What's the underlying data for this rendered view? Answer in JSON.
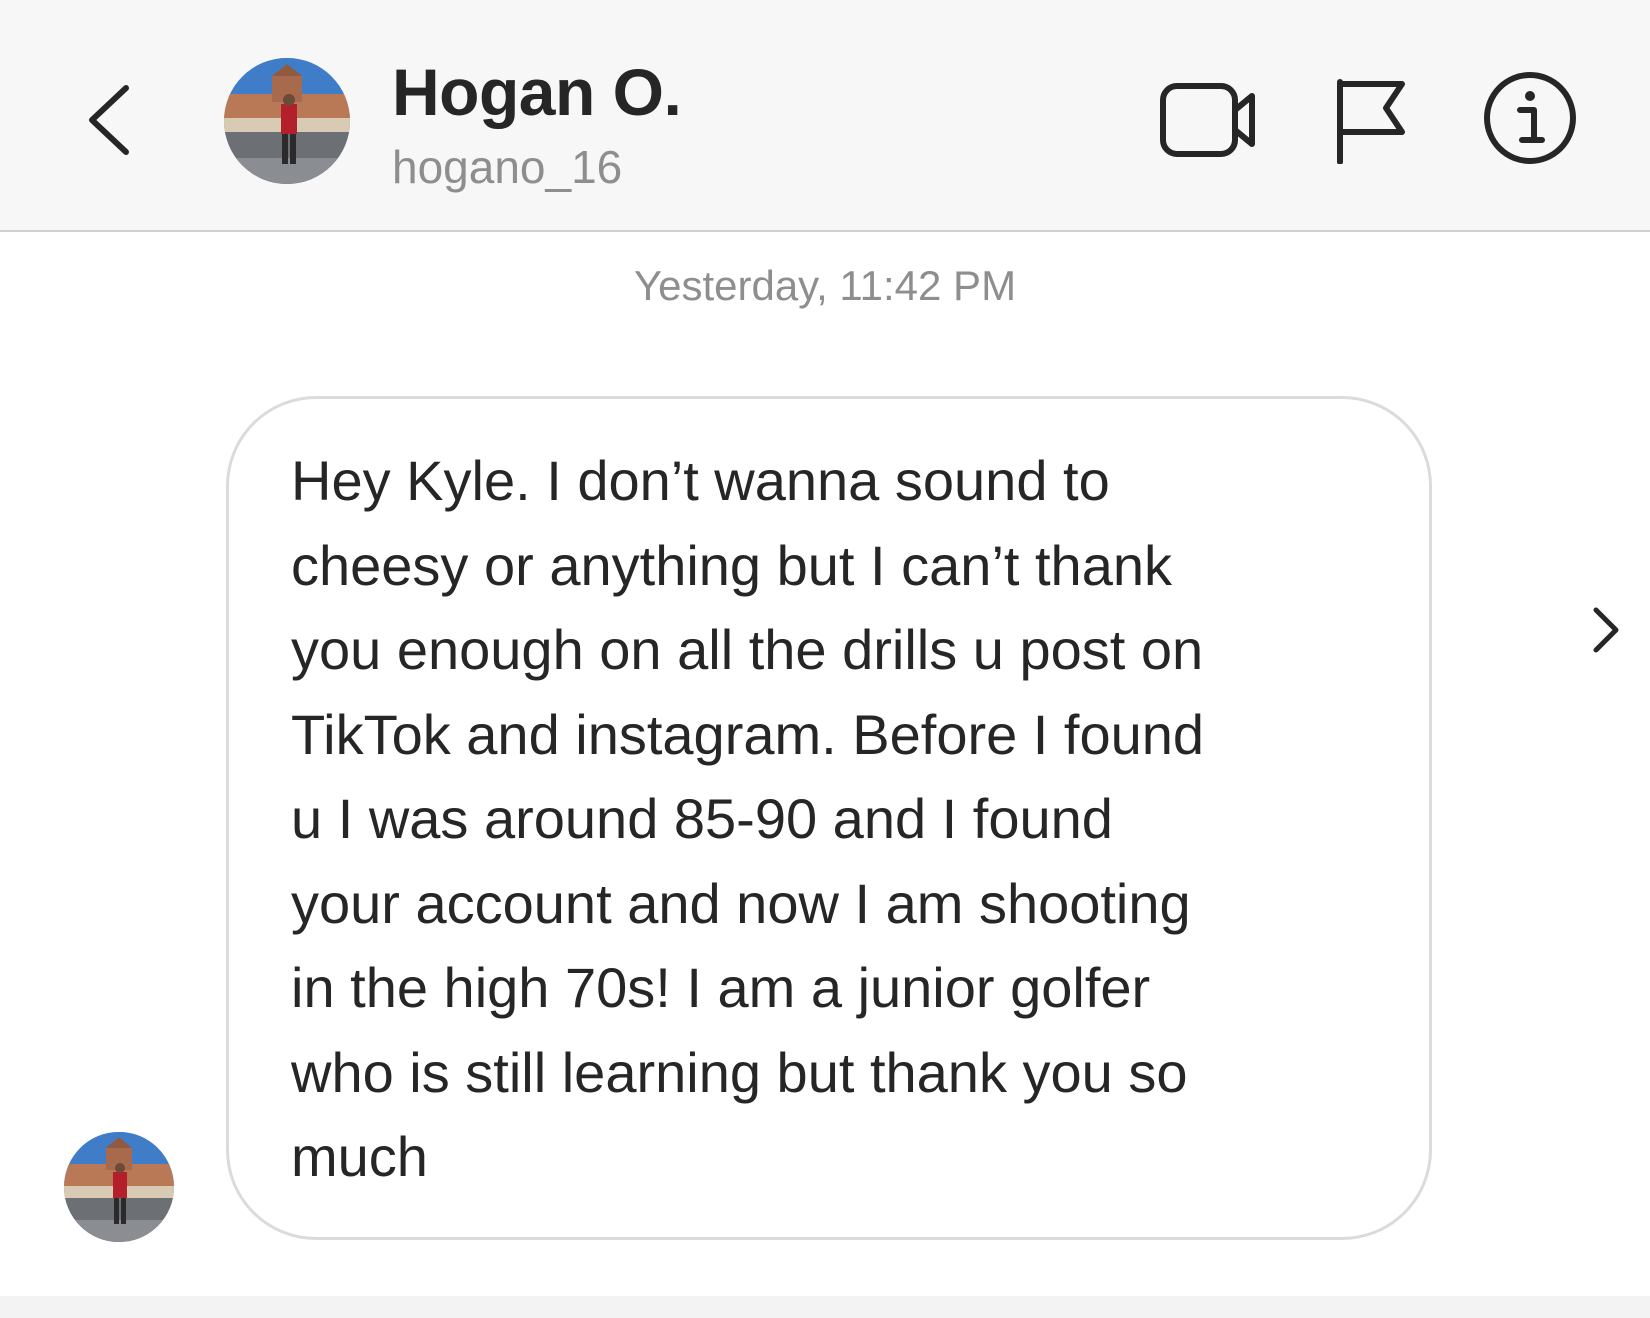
{
  "header": {
    "display_name": "Hogan O.",
    "username": "hogano_16",
    "back_icon": "chevron-left-icon",
    "actions": [
      {
        "name": "video-call",
        "icon": "video-camera-icon"
      },
      {
        "name": "report",
        "icon": "flag-icon"
      },
      {
        "name": "info",
        "icon": "info-icon"
      }
    ]
  },
  "thread": {
    "timestamp": "Yesterday, 11:42 PM",
    "messages": [
      {
        "sender": "Hogan O.",
        "text": "Hey Kyle. I don’t wanna sound to\ncheesy or anything but I can’t thank\nyou enough on all the drills u post on\nTikTok and instagram. Before I found\nu I was around 85-90 and I found\nyour account and now I am shooting\nin the high 70s! I am a junior golfer\nwho is still learning but thank you so\nmuch"
      }
    ]
  },
  "colors": {
    "header_bg": "#f7f7f7",
    "text_primary": "#262626",
    "text_secondary": "#8e8e8e",
    "bubble_border": "#dbdbdb"
  }
}
